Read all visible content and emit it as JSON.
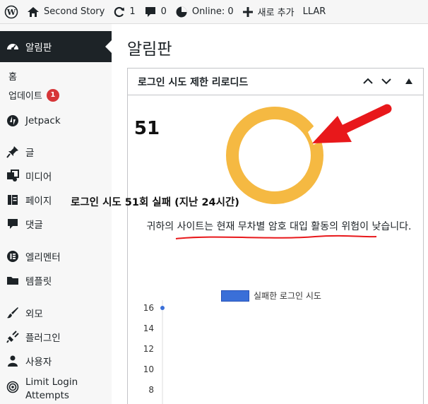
{
  "adminbar": {
    "site_name": "Second Story",
    "updates_count": "1",
    "comments_count": "0",
    "online_label": "Online: 0",
    "new_label": "새로 추가",
    "plugin_label": "LLAR"
  },
  "sidebar": {
    "dashboard_label": "알림판",
    "sub_home": "홈",
    "sub_updates": "업데이트",
    "updates_badge": "1",
    "items": [
      {
        "label": "Jetpack",
        "icon": "jetpack-icon"
      },
      {
        "label": "글",
        "icon": "pin-icon"
      },
      {
        "label": "미디어",
        "icon": "media-icon"
      },
      {
        "label": "페이지",
        "icon": "page-icon"
      },
      {
        "label": "댓글",
        "icon": "comment-icon"
      },
      {
        "label": "엘리멘터",
        "icon": "elementor-icon"
      },
      {
        "label": "템플릿",
        "icon": "folder-icon"
      },
      {
        "label": "외모",
        "icon": "brush-icon"
      },
      {
        "label": "플러그인",
        "icon": "plugin-icon"
      },
      {
        "label": "사용자",
        "icon": "user-icon"
      },
      {
        "label": "Limit Login Attempts",
        "icon": "llar-icon"
      }
    ]
  },
  "main": {
    "page_title": "알림판",
    "widget_title": "로그인 시도 제한 리로디드",
    "failed_count": "51",
    "failed_text": "로그인 시도 51회 실패 (지난 24시간)",
    "description": "귀하의 사이트는 현재 무차별 암호 대입 활동의 위험이 낮습니다.",
    "ring_color": "#f5b942",
    "arrow_color": "#e8181b",
    "underline_color": "#e8181b"
  },
  "chart_data": {
    "type": "line",
    "series": [
      {
        "name": "실패한 로그인 시도",
        "values": [
          16
        ]
      }
    ],
    "yticks": [
      "16",
      "14",
      "12",
      "10",
      "8"
    ],
    "ylim": [
      8,
      16
    ],
    "legend": "top"
  }
}
